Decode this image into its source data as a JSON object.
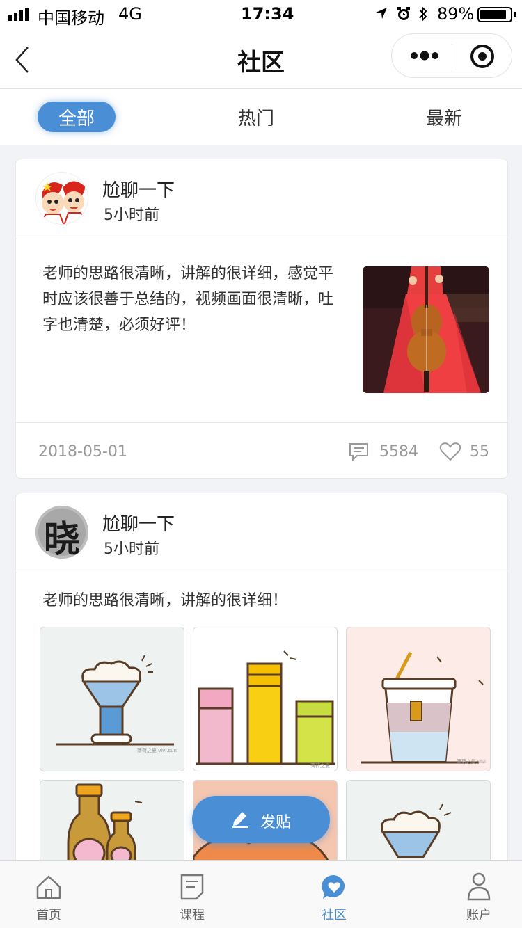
{
  "status_bar": {
    "carrier": "中国移动",
    "network": "4G",
    "time": "17:34",
    "battery": "89%",
    "battery_level": 0.89
  },
  "nav": {
    "title": "社区",
    "more_icon": "ellipsis-icon",
    "close_icon": "target-icon"
  },
  "tabs": [
    {
      "label": "全部",
      "active": true
    },
    {
      "label": "热门",
      "active": false
    },
    {
      "label": "最新",
      "active": false
    }
  ],
  "posts": [
    {
      "user": "尬聊一下",
      "time": "5小时前",
      "text": "老师的思路很清晰，讲解的很详细，感觉平时应该很善于总结的，视频画面很清晰，吐字也清楚，必须好评！",
      "date": "2018-05-01",
      "comments": "5584",
      "likes": "55"
    },
    {
      "user": "尬聊一下",
      "time": "5小时前",
      "text": "老师的思路很清晰，讲解的很详细！",
      "avatar_text": "晓"
    }
  ],
  "thumb_captions": [
    "薄荷之夏 vivi.sun",
    "薄荷之夏",
    "薄荷之夏 vivi"
  ],
  "fab": {
    "label": "发贴"
  },
  "tabbar": [
    {
      "label": "首页",
      "icon": "home-icon"
    },
    {
      "label": "课程",
      "icon": "document-icon"
    },
    {
      "label": "社区",
      "icon": "community-icon",
      "active": true
    },
    {
      "label": "账户",
      "icon": "person-icon"
    }
  ],
  "colors": {
    "accent": "#4a8fd6",
    "text": "#222222",
    "muted": "#999999"
  }
}
